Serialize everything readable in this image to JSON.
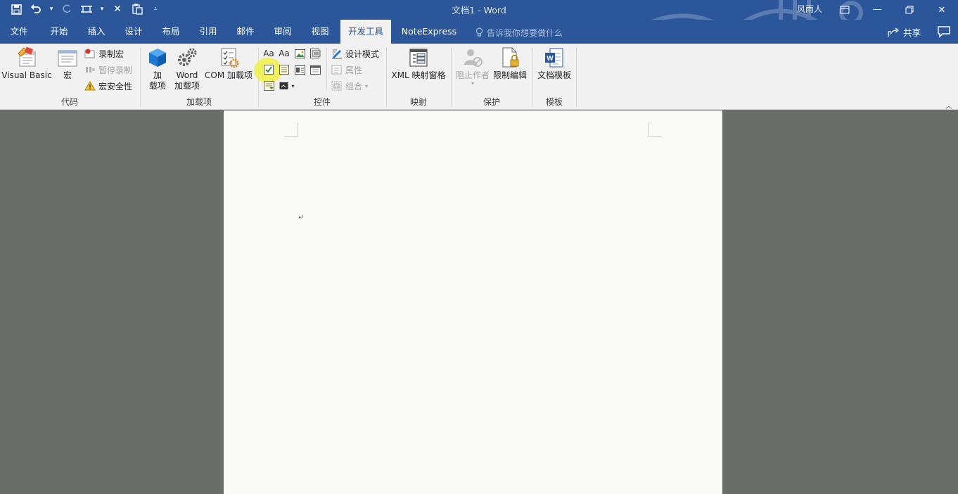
{
  "window": {
    "doc_title": "文档1  -  Word",
    "user": "风雨人"
  },
  "quick_access": {
    "icons": [
      "save-icon",
      "undo-icon",
      "redo-icon",
      "touch-mode-icon",
      "close-icon",
      "paste-icon",
      "customize-icon"
    ]
  },
  "tabs": [
    {
      "label": "文件"
    },
    {
      "label": "开始"
    },
    {
      "label": "插入"
    },
    {
      "label": "设计"
    },
    {
      "label": "布局"
    },
    {
      "label": "引用"
    },
    {
      "label": "邮件"
    },
    {
      "label": "审阅"
    },
    {
      "label": "视图"
    },
    {
      "label": "开发工具"
    },
    {
      "label": "NoteExpress"
    }
  ],
  "active_tab": "开发工具",
  "tell_me": "告诉我你想要做什么",
  "share": "共享",
  "ribbon": {
    "code": {
      "label": "代码",
      "visual_basic": "Visual Basic",
      "macros": "宏",
      "record_macro": "录制宏",
      "pause_recording": "暂停录制",
      "macro_security": "宏安全性"
    },
    "addins": {
      "label": "加载项",
      "addins_line1": "加",
      "addins_line2": "载项",
      "word_addins_line1": "Word",
      "word_addins_line2": "加载项",
      "com_addins": "COM 加载项"
    },
    "controls": {
      "label": "控件",
      "design_mode": "设计模式",
      "properties": "属性",
      "group": "组合"
    },
    "mapping": {
      "label": "映射",
      "xml_pane": "XML 映射窗格"
    },
    "protect": {
      "label": "保护",
      "block_authors": "阻止作者",
      "restrict_editing": "限制编辑"
    },
    "templates": {
      "label": "模板",
      "document_template": "文档模板"
    }
  },
  "colors": {
    "brand": "#2b579a",
    "ribbon_bg": "#f1f1f1",
    "workspace_bg": "#6b6d6a",
    "page_bg": "#fafbf9",
    "highlight": "#f0f046"
  }
}
